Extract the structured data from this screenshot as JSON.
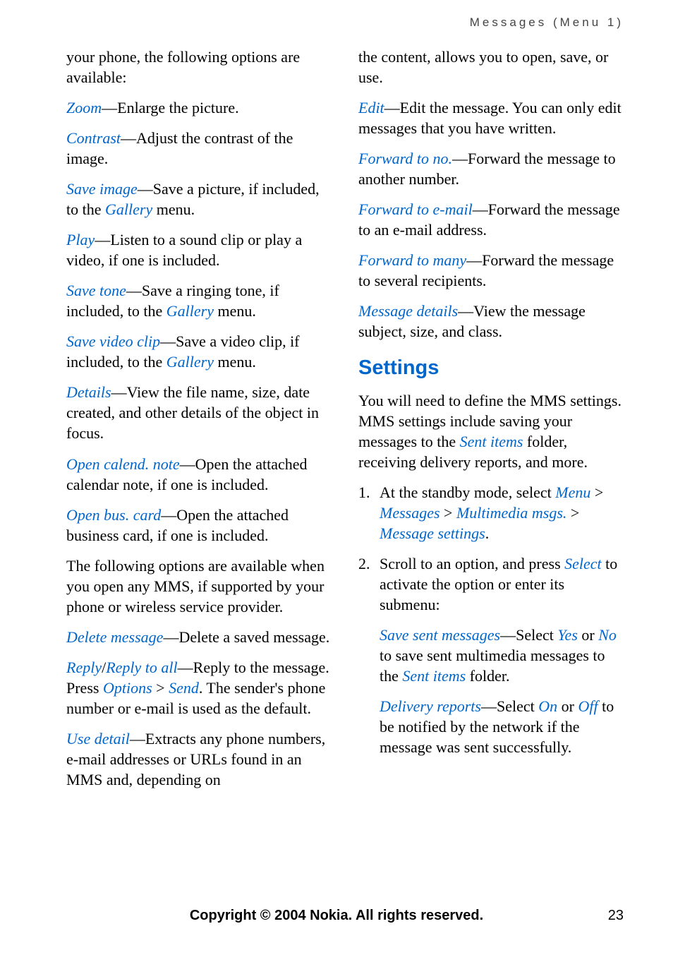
{
  "header": "Messages (Menu 1)",
  "left": {
    "intro": {
      "a": "your phone, the following options are available:"
    },
    "zoom": {
      "t": "Zoom",
      "d": "—Enlarge the picture."
    },
    "contrast": {
      "t": "Contrast",
      "d": "—Adjust the contrast of the image."
    },
    "saveimage": {
      "t": "Save image",
      "d1": "—Save a picture, if included, to the ",
      "g": "Gallery",
      "d2": " menu."
    },
    "play": {
      "t": "Play",
      "d": "—Listen to a sound clip or play a video, if one is included."
    },
    "savetone": {
      "t": "Save tone",
      "d1": "—Save a ringing tone, if included, to the ",
      "g": "Gallery",
      "d2": " menu."
    },
    "savevideo": {
      "t": "Save video clip",
      "d1": "—Save a video clip, if included, to the ",
      "g": "Gallery",
      "d2": " menu."
    },
    "details": {
      "t": "Details",
      "d": "—View the file name, size, date created, and other details of the object in focus."
    },
    "opencal": {
      "t": "Open calend. note",
      "d": "—Open the attached calendar note, if one is included."
    },
    "openbus": {
      "t": "Open bus. card",
      "d": "—Open the attached business card, if one is included."
    },
    "followopts": "The following options are available when you open any MMS, if supported by your phone or wireless service provider.",
    "delmsg": {
      "t": "Delete message",
      "d": "—Delete a saved message."
    },
    "reply": {
      "t1": "Reply",
      "slash": "/",
      "t2": "Reply to all",
      "d1": "—Reply to the message. Press ",
      "opt": "Options",
      "gt": " > ",
      "send": "Send",
      "d2": ". The sender's phone number or e-mail is used as the default."
    },
    "usedetail": {
      "t": "Use detail",
      "d": "—Extracts any phone numbers, e-mail addresses or URLs found in an MMS and, depending on"
    }
  },
  "right": {
    "cont": "the content, allows you to open, save, or use.",
    "edit": {
      "t": "Edit",
      "d": "—Edit the message. You can only edit messages that you have written."
    },
    "fwdno": {
      "t": "Forward to no.",
      "d": "—Forward the message to another number."
    },
    "fwdemail": {
      "t": "Forward to e-mail",
      "d": "—Forward the message to an e-mail address."
    },
    "fwdmany": {
      "t": "Forward to many",
      "d": "—Forward the message to several recipients."
    },
    "msgdet": {
      "t": "Message details",
      "d": "—View the message subject, size, and class."
    },
    "settings_h": "Settings",
    "settings_p": {
      "a": "You will need to define the MMS settings. MMS settings include saving your messages to the ",
      "sent": "Sent items",
      "b": " folder, receiving delivery reports, and more."
    },
    "step1": {
      "n": "1.",
      "a": "At the standby mode, select ",
      "menu": "Menu",
      "g1": " > ",
      "msgs": "Messages",
      "g2": " > ",
      "mms": "Multimedia msgs.",
      "g3": " > ",
      "mset": "Message settings",
      "dot": "."
    },
    "step2": {
      "n": "2.",
      "a": "Scroll to an option, and press ",
      "sel": "Select",
      "b": " to activate the option or enter its submenu:"
    },
    "savesent": {
      "t": "Save sent messages",
      "a": "—Select ",
      "yes": "Yes",
      "b": " or ",
      "no": "No",
      "c": " to save sent multimedia messages to the ",
      "si": "Sent items",
      "d": " folder."
    },
    "delrep": {
      "t": "Delivery reports",
      "a": "—Select ",
      "on": "On",
      "b": " or ",
      "off": "Off",
      "c": " to be notified by the network if the message was sent successfully."
    }
  },
  "footer": "Copyright © 2004 Nokia. All rights reserved.",
  "pagenum": "23"
}
